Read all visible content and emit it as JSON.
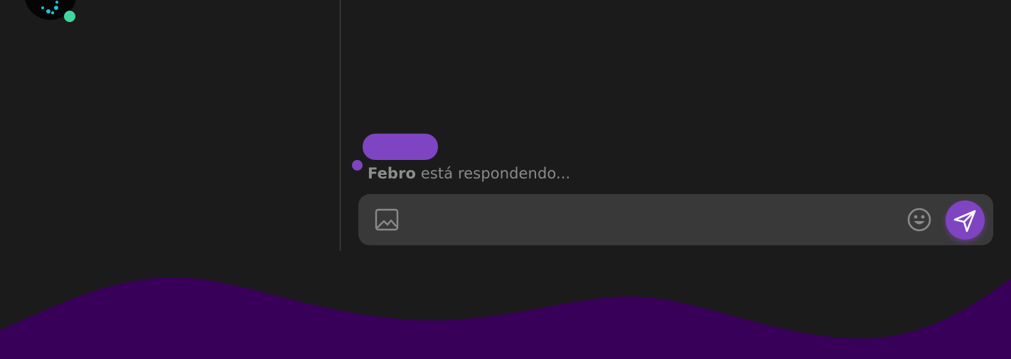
{
  "sidebar": {
    "avatar": {
      "status": "online",
      "status_color": "#3fd6a0"
    }
  },
  "chat": {
    "typing_indicator": {
      "name": "Febro",
      "text": "está respondendo..."
    },
    "composer": {
      "value": "",
      "placeholder": "",
      "attach_icon": "image-icon",
      "emoji_icon": "emoji-icon",
      "send_icon": "send-icon"
    }
  },
  "colors": {
    "background": "#1b1b1b",
    "accent": "#7f44c1",
    "composer": "#393939",
    "wave": "#380058",
    "online": "#3fd6a0"
  }
}
